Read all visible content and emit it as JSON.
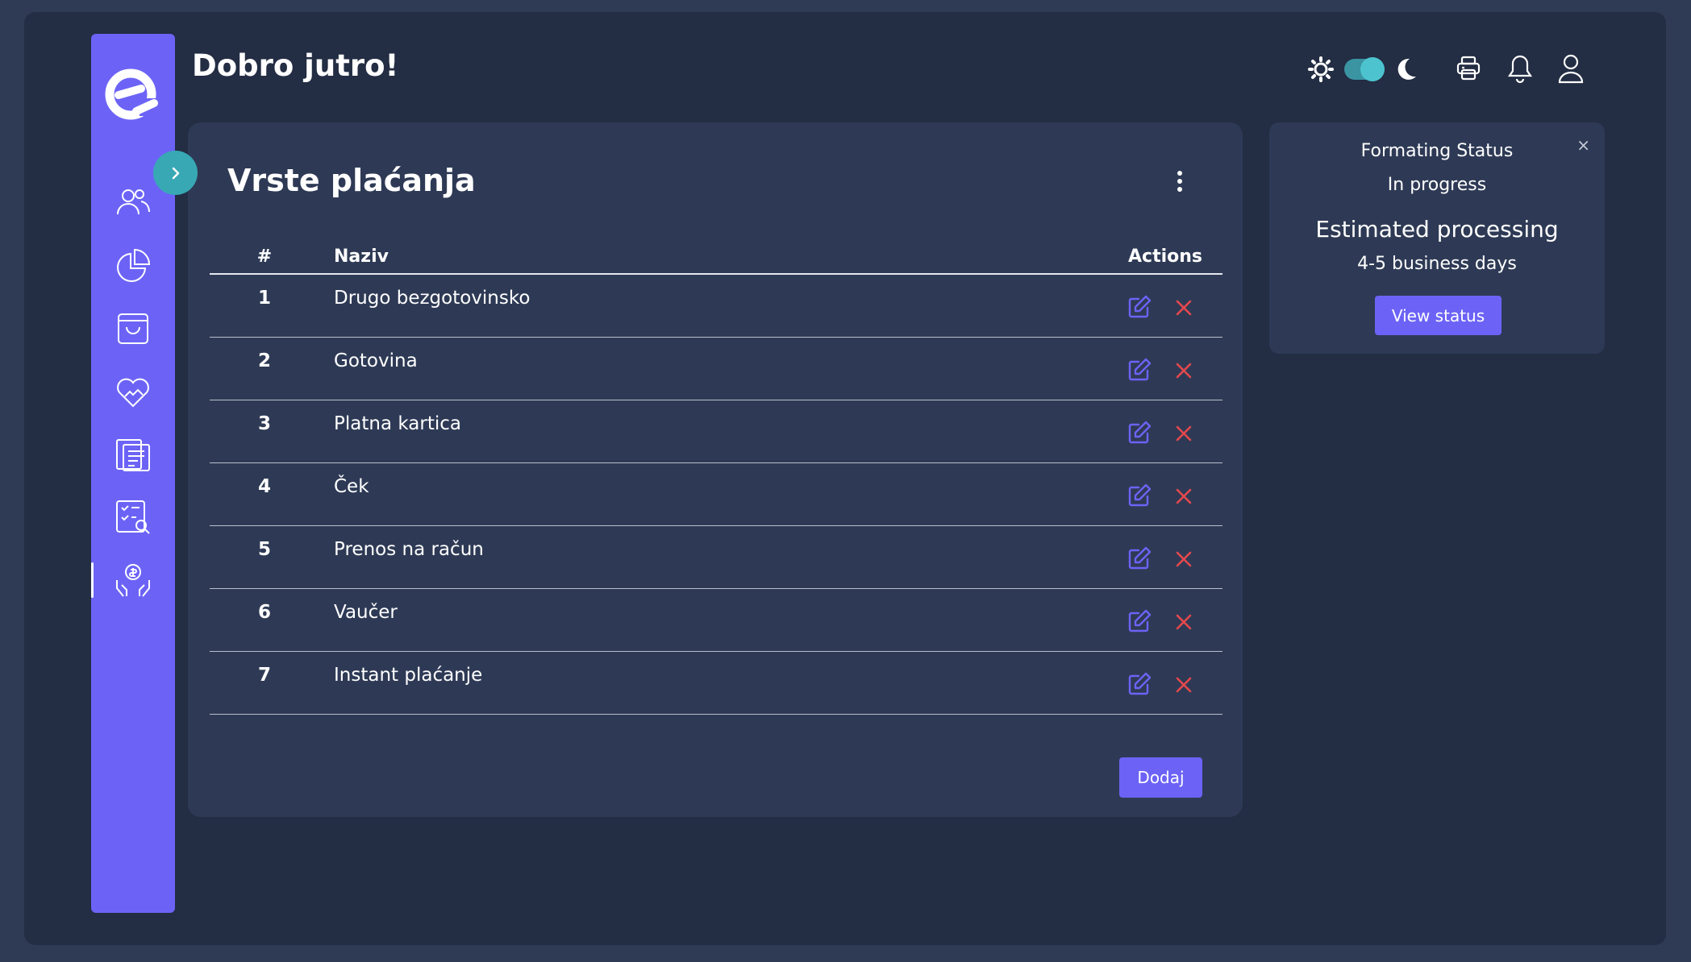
{
  "header": {
    "greeting": "Dobro jutro!"
  },
  "theme_toggle": {
    "mode": "dark"
  },
  "card": {
    "title": "Vrste plaćanja",
    "columns": {
      "num": "#",
      "name": "Naziv",
      "actions": "Actions"
    },
    "rows": [
      {
        "num": "1",
        "name": "Drugo bezgotovinsko"
      },
      {
        "num": "2",
        "name": "Gotovina"
      },
      {
        "num": "3",
        "name": "Platna kartica"
      },
      {
        "num": "4",
        "name": "Ček"
      },
      {
        "num": "5",
        "name": "Prenos na račun"
      },
      {
        "num": "6",
        "name": "Vaučer"
      },
      {
        "num": "7",
        "name": "Instant plaćanje"
      }
    ],
    "add_label": "Dodaj"
  },
  "status_card": {
    "title": "Formating Status",
    "subtitle": "In progress",
    "heading": "Estimated processing",
    "days": "4-5 business days",
    "button_label": "View status",
    "close_glyph": "×"
  },
  "colors": {
    "accent": "#6c63f6",
    "teal": "#38a8b5",
    "danger": "#e5484d",
    "background": "#232d43",
    "card": "#2e3a55"
  },
  "icons": {
    "sidebar": [
      "users-icon",
      "pie-chart-icon",
      "shopping-bag-icon",
      "handshake-heart-icon",
      "documents-icon",
      "checklist-search-icon",
      "hands-coin-icon"
    ],
    "header": [
      "sun-icon",
      "moon-icon",
      "printer-icon",
      "bell-icon",
      "user-icon"
    ]
  }
}
